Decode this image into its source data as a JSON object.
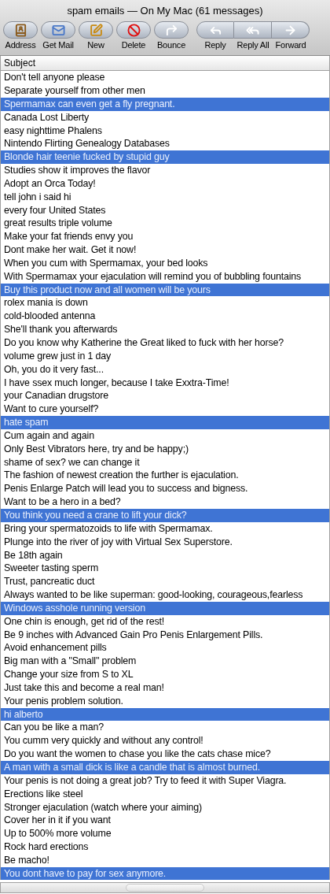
{
  "window": {
    "title": "spam emails — On My Mac (61 messages)"
  },
  "toolbar": {
    "buttons": [
      {
        "label": "Address",
        "kind": "single"
      },
      {
        "label": "Get Mail",
        "kind": "single"
      },
      {
        "label": "New",
        "kind": "single"
      },
      {
        "label": "Delete",
        "kind": "single"
      },
      {
        "label": "Bounce",
        "kind": "single"
      },
      {
        "label": "Reply",
        "kind": "segment"
      },
      {
        "label": "Reply All",
        "kind": "segment"
      },
      {
        "label": "Forward",
        "kind": "segment"
      }
    ]
  },
  "table": {
    "columns": [
      "Subject"
    ],
    "rows": [
      {
        "subject": "Don't tell anyone please",
        "selected": false
      },
      {
        "subject": "Separate yourself from other men",
        "selected": false
      },
      {
        "subject": "Spermamax can even get a fly pregnant.",
        "selected": true
      },
      {
        "subject": "Canada Lost Liberty",
        "selected": false
      },
      {
        "subject": "easy nighttime Phalens",
        "selected": false
      },
      {
        "subject": "Nintendo Flirting Genealogy Databases",
        "selected": false
      },
      {
        "subject": "Blonde hair teenie fucked by stupid guy",
        "selected": true
      },
      {
        "subject": "Studies show it improves the flavor",
        "selected": false
      },
      {
        "subject": "Adopt an Orca Today!",
        "selected": false
      },
      {
        "subject": "tell john i said hi",
        "selected": false
      },
      {
        "subject": "every four United States",
        "selected": false
      },
      {
        "subject": "great results triple volume",
        "selected": false
      },
      {
        "subject": "Make your fat friends envy you",
        "selected": false
      },
      {
        "subject": "Dont make her wait. Get it now!",
        "selected": false
      },
      {
        "subject": "When you cum with Spermamax, your bed looks",
        "selected": false
      },
      {
        "subject": "With Spermamax your ejaculation will remind you of bubbling fountains",
        "selected": false
      },
      {
        "subject": "Buy this product now and all women will be yours",
        "selected": true
      },
      {
        "subject": "rolex mania is down",
        "selected": false
      },
      {
        "subject": "cold-blooded antenna",
        "selected": false
      },
      {
        "subject": "She'll thank you afterwards",
        "selected": false
      },
      {
        "subject": "Do you know why Katherine the Great liked to fuck with her horse?",
        "selected": false
      },
      {
        "subject": "volume grew just in 1 day",
        "selected": false
      },
      {
        "subject": "Oh, you do it very fast...",
        "selected": false
      },
      {
        "subject": "I have ssex much longer, because I take Exxtra-Time!",
        "selected": false
      },
      {
        "subject": "your Canadian drugstore",
        "selected": false
      },
      {
        "subject": "Want to cure yourself?",
        "selected": false
      },
      {
        "subject": "hate spam",
        "selected": true
      },
      {
        "subject": "Cum again and again",
        "selected": false
      },
      {
        "subject": "Only Best Vibrators here, try and be happy;)",
        "selected": false
      },
      {
        "subject": "shame of sex? we can change it",
        "selected": false
      },
      {
        "subject": "The fashion of newest creation  the further is ejaculation.",
        "selected": false
      },
      {
        "subject": "Penis Enlarge Patch will lead you to success and bigness.",
        "selected": false
      },
      {
        "subject": "Want to be a hero in a bed?",
        "selected": false
      },
      {
        "subject": "You think you need a crane to lift your dick?",
        "selected": true
      },
      {
        "subject": "Bring your spermatozoids to life with Spermamax.",
        "selected": false
      },
      {
        "subject": "Plunge into the river of joy with Virtual Sex Superstore.",
        "selected": false
      },
      {
        "subject": "Be 18th again",
        "selected": false
      },
      {
        "subject": "Sweeter tasting sperm",
        "selected": false
      },
      {
        "subject": "Trust, pancreatic duct",
        "selected": false
      },
      {
        "subject": "Always wanted to be like superman: good-looking, courageous,fearless",
        "selected": false
      },
      {
        "subject": "Windows asshole running version",
        "selected": true
      },
      {
        "subject": "One chin is enough, get rid of the rest!",
        "selected": false
      },
      {
        "subject": "Be 9 inches with Advanced Gain Pro Penis Enlargement Pills.",
        "selected": false
      },
      {
        "subject": "Avoid enhancement pills",
        "selected": false
      },
      {
        "subject": "Big man with a \"Small\" problem",
        "selected": false
      },
      {
        "subject": "Change your size from S to XL",
        "selected": false
      },
      {
        "subject": "Just take this and become a real man!",
        "selected": false
      },
      {
        "subject": "Your penis problem solution.",
        "selected": false
      },
      {
        "subject": "hi alberto",
        "selected": true
      },
      {
        "subject": "Can you be like a man?",
        "selected": false
      },
      {
        "subject": "You cumm very quickly and without any control!",
        "selected": false
      },
      {
        "subject": "Do you want the women to chase you like the cats chase mice?",
        "selected": false
      },
      {
        "subject": "A man with a small dick is like a candle that is almost burned.",
        "selected": true
      },
      {
        "subject": "Your penis is not doing a great job? Try to feed it with Super Viagra.",
        "selected": false
      },
      {
        "subject": "Erections like steel",
        "selected": false
      },
      {
        "subject": "Stronger ejaculation (watch where your aiming)",
        "selected": false
      },
      {
        "subject": "Cover her in it if you want",
        "selected": false
      },
      {
        "subject": "Up to 500% more volume",
        "selected": false
      },
      {
        "subject": "Rock hard erections",
        "selected": false
      },
      {
        "subject": "Be macho!",
        "selected": false
      },
      {
        "subject": "You dont have to pay for sex anymore.",
        "selected": true
      }
    ]
  }
}
